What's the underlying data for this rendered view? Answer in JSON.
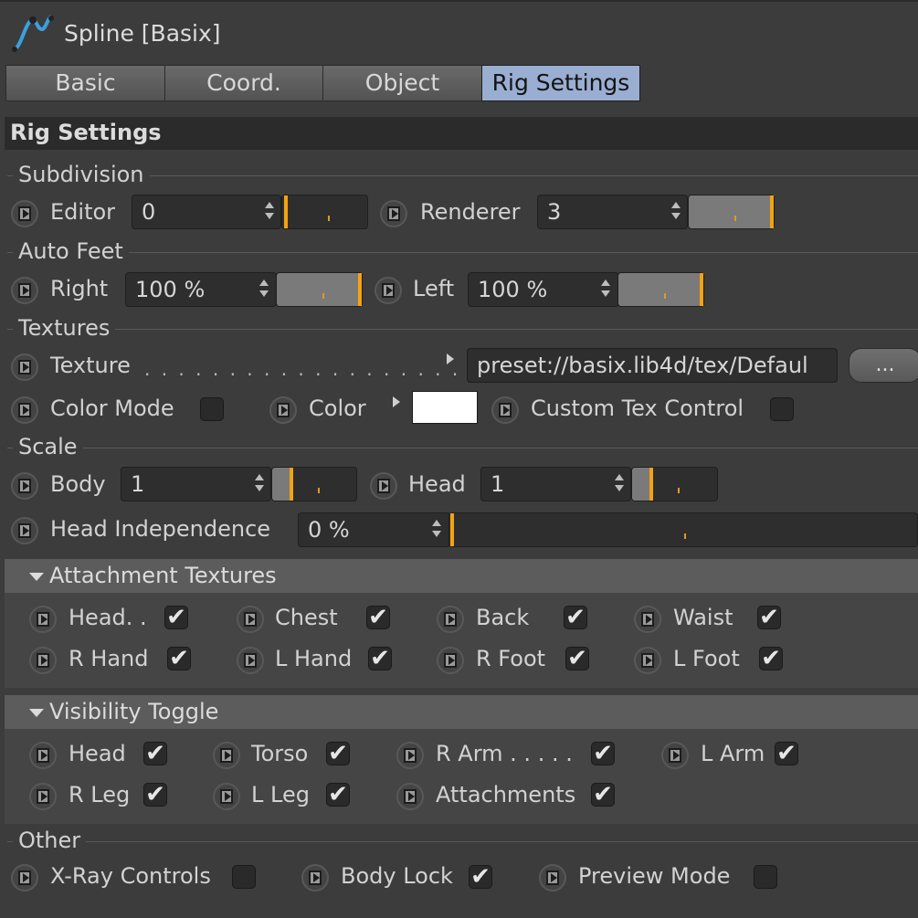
{
  "header": {
    "title": "Spline [Basix]"
  },
  "tabs": [
    {
      "label": "Basic",
      "active": false
    },
    {
      "label": "Coord.",
      "active": false
    },
    {
      "label": "Object",
      "active": false
    },
    {
      "label": "Rig Settings",
      "active": true
    }
  ],
  "panel": {
    "title": "Rig Settings"
  },
  "subdivision": {
    "title": "Subdivision",
    "editor_label": "Editor",
    "editor_value": "0",
    "renderer_label": "Renderer",
    "renderer_value": "3"
  },
  "auto_feet": {
    "title": "Auto Feet",
    "right_label": "Right",
    "right_value": "100 %",
    "left_label": "Left",
    "left_value": "100 %"
  },
  "textures": {
    "title": "Textures",
    "texture_label": "Texture",
    "texture_dots": ". . . . . . . . . . . . . . . . . . .",
    "texture_path": "preset://basix.lib4d/tex/Defaul",
    "browse_label": "...",
    "color_mode_label": "Color Mode",
    "color_mode_checked": false,
    "color_label": "Color",
    "color_value": "#ffffff",
    "custom_tex_label": "Custom Tex Control",
    "custom_tex_checked": false
  },
  "scale": {
    "title": "Scale",
    "body_label": "Body",
    "body_value": "1",
    "head_label": "Head",
    "head_value": "1",
    "head_indep_label": "Head Independence",
    "head_indep_value": "0 %"
  },
  "attachment_textures": {
    "title": "Attachment Textures",
    "items": [
      {
        "label": "Head. .",
        "checked": true
      },
      {
        "label": "Chest",
        "checked": true
      },
      {
        "label": "Back",
        "checked": true
      },
      {
        "label": "Waist",
        "checked": true
      },
      {
        "label": "R Hand",
        "checked": true
      },
      {
        "label": "L Hand",
        "checked": true
      },
      {
        "label": "R Foot",
        "checked": true
      },
      {
        "label": "L Foot",
        "checked": true
      }
    ]
  },
  "visibility_toggle": {
    "title": "Visibility Toggle",
    "items": [
      {
        "label": "Head",
        "checked": true
      },
      {
        "label": "Torso",
        "checked": true
      },
      {
        "label": "R Arm . . . . .",
        "checked": true
      },
      {
        "label": "L Arm",
        "checked": true
      },
      {
        "label": "R Leg",
        "checked": true
      },
      {
        "label": "L Leg",
        "checked": true
      },
      {
        "label": "Attachments",
        "checked": true
      }
    ]
  },
  "other": {
    "title": "Other",
    "xray_label": "X-Ray Controls",
    "xray_checked": false,
    "body_lock_label": "Body Lock",
    "body_lock_checked": true,
    "preview_label": "Preview Mode",
    "preview_checked": false
  },
  "check_glyph": "✔",
  "colors": {
    "accent": "#f3a312",
    "active_tab": "#9aaed2",
    "background": "#3c3c3c"
  }
}
